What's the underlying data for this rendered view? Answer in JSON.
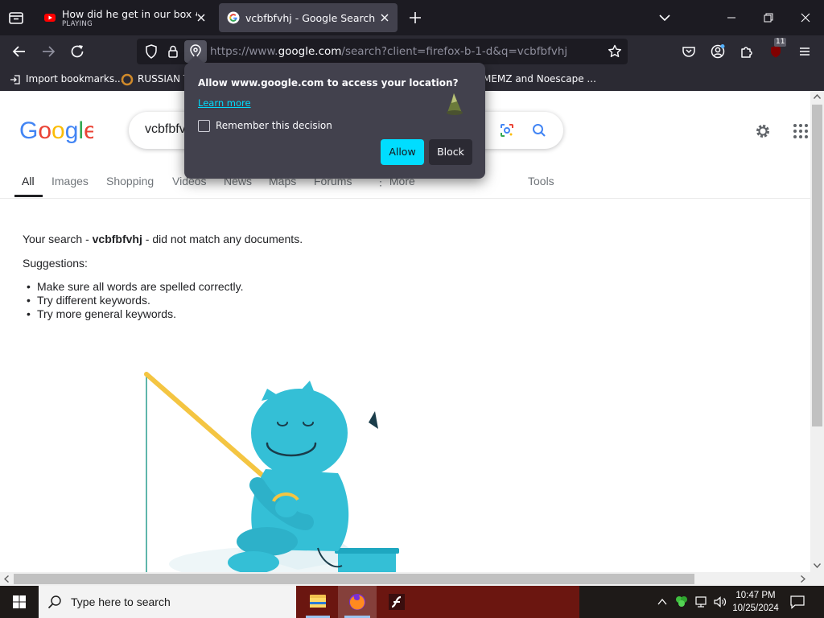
{
  "browser": {
    "tabs": [
      {
        "title": "How did he get in our box 😭🎸",
        "status": "PLAYING",
        "favicon": "youtube-icon"
      },
      {
        "title": "vcbfbfvhj - Google Search",
        "favicon": "google-icon"
      }
    ],
    "url": {
      "prefix": "https://www.",
      "domain": "google.com",
      "rest": "/search?client=firefox-b-1-d&q=vcbfbfvhj"
    },
    "extension_badge": "11",
    "bookmarks": [
      {
        "label": "Import bookmarks...",
        "icon": "import-icon"
      },
      {
        "label": "RUSSIAN TI",
        "icon": "bookmark-favicon"
      },
      {
        "label": "MEMZ and Noescape ...",
        "icon": "bookmark-favicon"
      }
    ]
  },
  "permission_popup": {
    "message": "Allow www.google.com to access your location?",
    "learn_more": "Learn more",
    "remember": "Remember this decision",
    "allow": "Allow",
    "block": "Block"
  },
  "google": {
    "query": "vcbfbfv",
    "tabs": [
      "All",
      "Images",
      "Shopping",
      "Videos",
      "News",
      "Maps",
      "Forums",
      "More"
    ],
    "tools": "Tools",
    "no_results": {
      "prefix": "Your search - ",
      "query": "vcbfbfvhj",
      "suffix": " - did not match any documents.",
      "suggestions_label": "Suggestions:",
      "suggestions": [
        "Make sure all words are spelled correctly.",
        "Try different keywords.",
        "Try more general keywords."
      ]
    }
  },
  "taskbar": {
    "search_placeholder": "Type here to search",
    "time": "10:47 PM",
    "date": "10/25/2024"
  },
  "colors": {
    "allow_button": "#00ddff",
    "chrome_dark": "#1c1b22",
    "chrome_mid": "#2b2a33",
    "popup_bg": "#42414d",
    "yeti": "#34bfd6"
  }
}
